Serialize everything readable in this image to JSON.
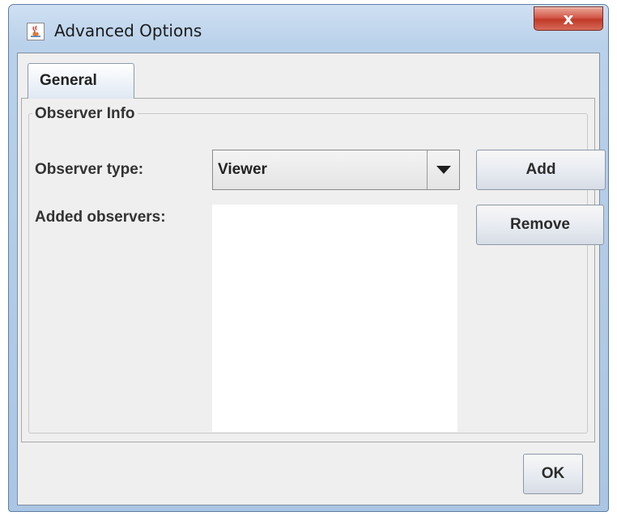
{
  "window": {
    "title": "Advanced Options",
    "close_label": "x"
  },
  "tabs": [
    {
      "label": "General",
      "selected": true
    }
  ],
  "observer_info": {
    "group_title": "Observer Info",
    "observer_type_label": "Observer type:",
    "observer_type_value": "Viewer",
    "added_observers_label": "Added observers:",
    "added_observers": [],
    "add_label": "Add",
    "remove_label": "Remove"
  },
  "footer": {
    "ok_label": "OK"
  },
  "icons": {
    "app": "java-coffee-cup-icon",
    "dropdown": "chevron-down-icon",
    "close": "close-icon"
  }
}
